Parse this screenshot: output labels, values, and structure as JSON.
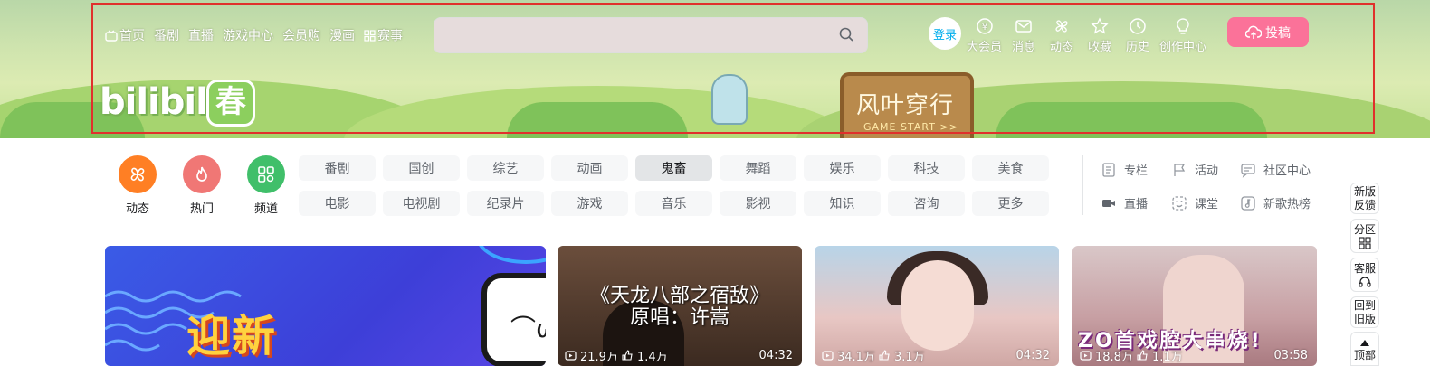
{
  "header": {
    "nav": [
      {
        "label": "首页",
        "icon": "tv-icon"
      },
      {
        "label": "番剧"
      },
      {
        "label": "直播"
      },
      {
        "label": "游戏中心"
      },
      {
        "label": "会员购"
      },
      {
        "label": "漫画"
      },
      {
        "label": "赛事",
        "icon": "grid-icon"
      }
    ],
    "search_placeholder": "",
    "login_label": "登录",
    "right_nav": [
      {
        "label": "大会员",
        "icon": "vip-icon"
      },
      {
        "label": "消息",
        "icon": "mail-icon"
      },
      {
        "label": "动态",
        "icon": "fan-icon"
      },
      {
        "label": "收藏",
        "icon": "star-icon"
      },
      {
        "label": "历史",
        "icon": "clock-icon"
      },
      {
        "label": "创作中心",
        "icon": "bulb-icon"
      }
    ],
    "upload_label": "投稿"
  },
  "banner": {
    "logo_text": "bilibili",
    "logo_badge": "春",
    "sign_title": "风叶穿行",
    "sign_subtitle": "GAME START >>"
  },
  "quick_entries": [
    {
      "label": "动态",
      "color": "#ff7f24"
    },
    {
      "label": "热门",
      "color": "#f07775"
    },
    {
      "label": "频道",
      "color": "#40bf6a"
    }
  ],
  "channels": [
    "番剧",
    "国创",
    "综艺",
    "动画",
    "鬼畜",
    "舞蹈",
    "娱乐",
    "科技",
    "美食",
    "电影",
    "电视剧",
    "纪录片",
    "游戏",
    "音乐",
    "影视",
    "知识",
    "咨询",
    "更多"
  ],
  "side_links": [
    {
      "label": "专栏",
      "icon": "article-icon"
    },
    {
      "label": "活动",
      "icon": "flag-icon"
    },
    {
      "label": "社区中心",
      "icon": "chat-icon"
    },
    {
      "label": "直播",
      "icon": "camera-icon"
    },
    {
      "label": "课堂",
      "icon": "smile-icon"
    },
    {
      "label": "新歌热榜",
      "icon": "music-icon"
    }
  ],
  "floating_tools": [
    {
      "label": "新版反馈"
    },
    {
      "label": "分区",
      "icon": "grid-icon"
    },
    {
      "label": "客服",
      "icon": "headset-icon"
    },
    {
      "label": "回到旧版"
    },
    {
      "label": "顶部",
      "icon": "up-arrow-icon"
    }
  ],
  "featured": {
    "title": "迎新"
  },
  "videos": [
    {
      "overlay_line1": "《天龙八部之宿敌》",
      "overlay_line2": "原唱：许嵩",
      "views": "21.9万",
      "likes": "1.4万",
      "duration": "04:32"
    },
    {
      "views": "34.1万",
      "likes": "3.1万",
      "duration": "04:32"
    },
    {
      "overlay_line1": "ZO首戏腔大串烧!",
      "views": "18.8万",
      "likes": "1.1万",
      "duration": "03:58"
    }
  ],
  "colors": {
    "accent": "#00aeec",
    "upload": "#fb7299",
    "highlight": "#e0302c"
  }
}
